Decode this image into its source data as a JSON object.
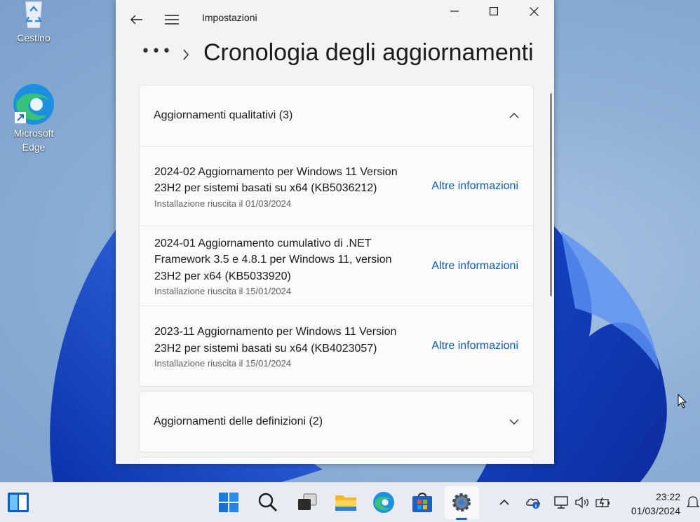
{
  "desktop": {
    "icons": [
      {
        "label": "Cestino",
        "icon": "recycle-bin-icon"
      },
      {
        "label": "Microsoft Edge",
        "icon": "edge-icon"
      }
    ]
  },
  "window": {
    "app_title": "Impostazioni",
    "breadcrumb_overflow": "•••",
    "page_title": "Cronologia degli aggiornamenti"
  },
  "quality_updates": {
    "header": "Aggiornamenti qualitativi (3)",
    "expanded": true,
    "items": [
      {
        "title": "2024-02 Aggiornamento per Windows 11 Version 23H2 per sistemi basati su x64 (KB5036212)",
        "status": "Installazione riuscita il 01/03/2024",
        "link": "Altre informazioni"
      },
      {
        "title": "2024-01 Aggiornamento cumulativo di .NET Framework 3.5 e 4.8.1 per Windows 11, version 23H2 per x64 (KB5033920)",
        "status": "Installazione riuscita il 15/01/2024",
        "link": "Altre informazioni"
      },
      {
        "title": "2023-11 Aggiornamento per Windows 11 Version 23H2 per sistemi basati su x64 (KB4023057)",
        "status": "Installazione riuscita il 15/01/2024",
        "link": "Altre informazioni"
      }
    ]
  },
  "definition_updates": {
    "header": "Aggiornamenti delle definizioni (2)",
    "expanded": false
  },
  "taskbar": {
    "time": "23:22",
    "date": "01/03/2024"
  },
  "colors": {
    "accent": "#0f5bb5",
    "taskbar_indicator": "#0a64c8"
  }
}
